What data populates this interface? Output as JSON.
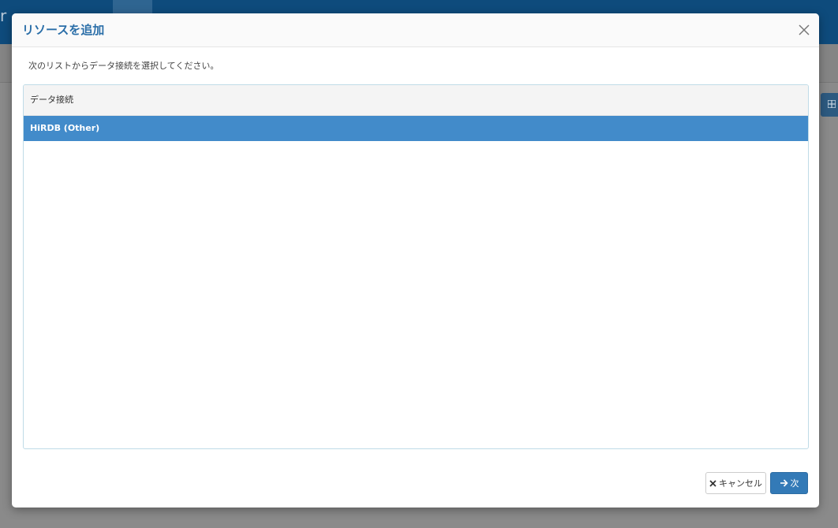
{
  "modal": {
    "title": "リソースを追加",
    "instruction": "次のリストからデータ接続を選択してください。",
    "list": {
      "header": "データ接続",
      "items": [
        {
          "label": "HiRDB (Other)",
          "selected": true
        }
      ]
    },
    "buttons": {
      "cancel_label": "キャンセル",
      "next_label": "次"
    }
  },
  "colors": {
    "title": "#2a6ea8",
    "selected_row": "#428bca",
    "primary_button": "#337ab7",
    "topbar": "#0e4b7c"
  },
  "icons": {
    "close": "close-icon",
    "cancel": "x-icon",
    "next": "arrow-right-icon",
    "background_button": "grid-icon"
  }
}
